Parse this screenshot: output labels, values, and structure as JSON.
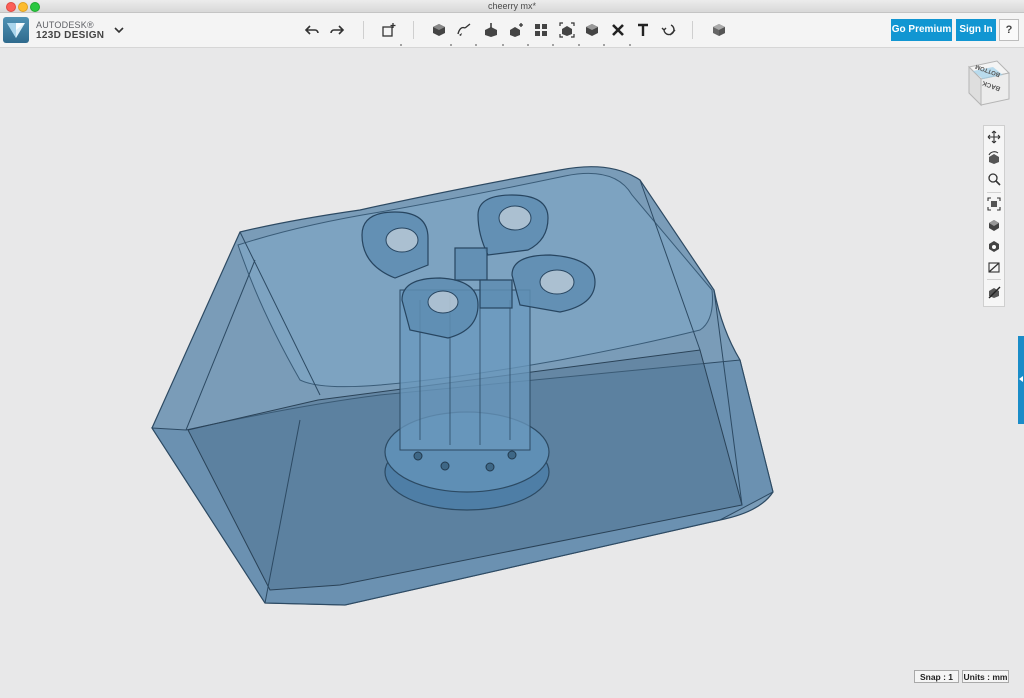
{
  "window": {
    "title": "cheerry mx*"
  },
  "brand": {
    "company": "AUTODESK",
    "product": "123D DESIGN",
    "registered_mark": "®"
  },
  "toolbar": {
    "tools": [
      {
        "name": "undo-icon"
      },
      {
        "name": "redo-icon"
      },
      {
        "name": "new-primitive-icon"
      },
      {
        "name": "primitives-icon"
      },
      {
        "name": "sketch-icon"
      },
      {
        "name": "construct-icon"
      },
      {
        "name": "modify-icon"
      },
      {
        "name": "pattern-icon"
      },
      {
        "name": "group-icon"
      },
      {
        "name": "combine-icon"
      },
      {
        "name": "measure-icon"
      },
      {
        "name": "text-icon"
      },
      {
        "name": "snap-icon"
      },
      {
        "name": "material-icon"
      }
    ],
    "premium_label": "Go Premium",
    "signin_label": "Sign In",
    "help_label": "?"
  },
  "viewcube": {
    "top_label": "BOTTOM",
    "face_label": "BACK"
  },
  "nav_tools": [
    {
      "name": "pan-icon"
    },
    {
      "name": "orbit-icon"
    },
    {
      "name": "zoom-icon"
    },
    {
      "name": "fit-icon"
    },
    {
      "name": "view-solid-icon"
    },
    {
      "name": "view-outline-icon"
    },
    {
      "name": "hide-sketches-icon"
    },
    {
      "name": "hide-meshes-icon"
    }
  ],
  "status": {
    "snap": "Snap : 1",
    "units": "Units : mm"
  },
  "colors": {
    "accent": "#1196d2",
    "model": "#4d7fa4",
    "background": "#e8e8e9"
  }
}
